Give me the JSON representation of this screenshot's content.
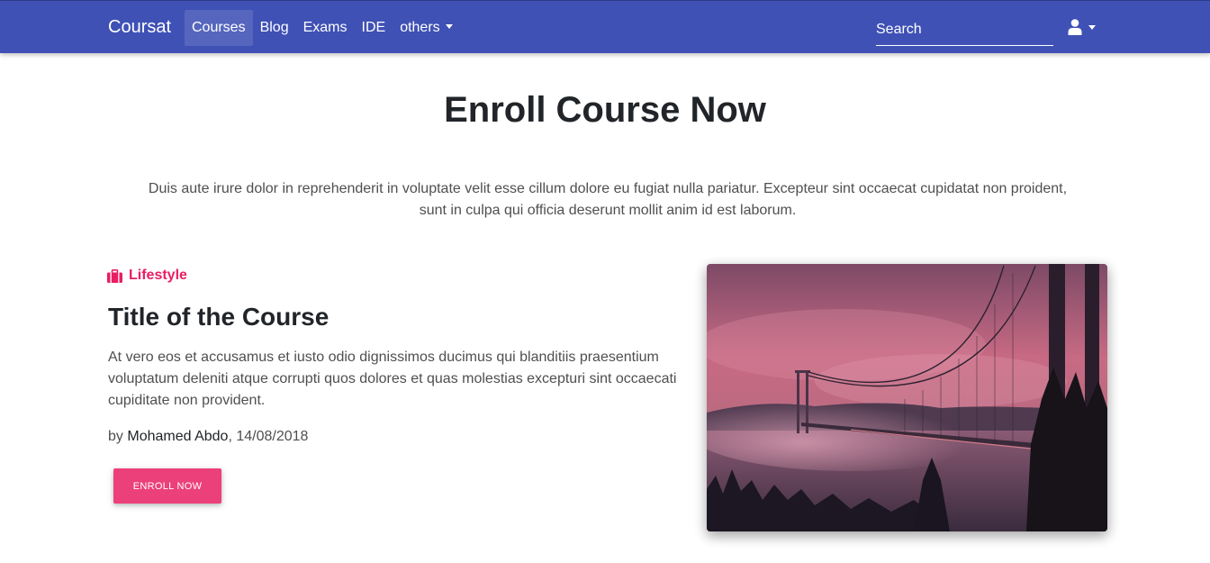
{
  "navbar": {
    "brand": "Coursat",
    "links": [
      {
        "label": "Courses",
        "active": true
      },
      {
        "label": "Blog",
        "active": false
      },
      {
        "label": "Exams",
        "active": false
      },
      {
        "label": "IDE",
        "active": false
      },
      {
        "label": "others",
        "active": false,
        "dropdown": true
      }
    ],
    "search_placeholder": "Search",
    "user_icon": "user-icon",
    "color": "#3f51b5"
  },
  "main": {
    "title": "Enroll Course Now",
    "lead": "Duis aute irure dolor in reprehenderit in voluptate velit esse cillum dolore eu fugiat nulla pariatur. Excepteur sint occaecat cupidatat non proident, sunt in culpa qui officia deserunt mollit anim id est laborum."
  },
  "course": {
    "category": "Lifestyle",
    "category_icon": "briefcase-icon",
    "category_color": "#e91e63",
    "title": "Title of the Course",
    "description": "At vero eos et accusamus et iusto odio dignissimos ducimus qui blanditiis praesentium voluptatum deleniti atque corrupti quos dolores et quas molestias excepturi sint occaecati cupiditate non provident.",
    "by_label": "by",
    "author": "Mohamed Abdo",
    "date": ", 14/08/2018",
    "button_label": "ENROLL NOW",
    "button_color": "#ec407a"
  }
}
